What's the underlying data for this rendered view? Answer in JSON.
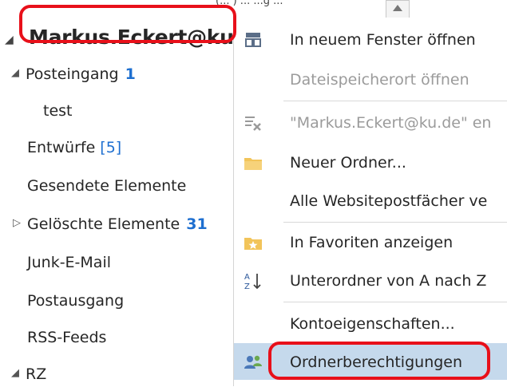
{
  "top_strip": {
    "partial_text": "(...                ) ...                    ...g ..."
  },
  "account": {
    "name": "Markus.Eckert@ku"
  },
  "folders": [
    {
      "label": "Posteingang",
      "count": "1",
      "expand": "open"
    },
    {
      "label": "test"
    },
    {
      "label": "Entwürfe",
      "bracket_count": "[5]"
    },
    {
      "label": "Gesendete Elemente"
    },
    {
      "label": "Gelöschte Elemente",
      "count": "31",
      "expand": "closed"
    },
    {
      "label": "Junk-E-Mail"
    },
    {
      "label": "Postausgang"
    },
    {
      "label": "RSS-Feeds"
    },
    {
      "label": "RZ",
      "expand": "open"
    }
  ],
  "menu": {
    "items": [
      {
        "label": "In neuem Fenster öffnen",
        "icon": "new-window-icon",
        "enabled": true
      },
      {
        "label": "Dateispeicherort öffnen",
        "icon": "",
        "enabled": false
      },
      {
        "label": "\"Markus.Eckert@ku.de\" en",
        "icon": "remove-account-icon",
        "enabled": false
      },
      {
        "label": "Neuer Ordner...",
        "icon": "folder-icon",
        "enabled": true
      },
      {
        "label": "Alle Websitepostfächer ve",
        "icon": "",
        "enabled": true
      },
      {
        "label": "In Favoriten anzeigen",
        "icon": "favorite-star-icon",
        "enabled": true
      },
      {
        "label": "Unterordner von A nach Z",
        "icon": "sort-az-icon",
        "enabled": true
      },
      {
        "label": "Kontoeigenschaften...",
        "icon": "",
        "enabled": true
      },
      {
        "label": "Ordnerberechtigungen",
        "icon": "permissions-icon",
        "enabled": true,
        "highlighted": true
      }
    ]
  },
  "colors": {
    "highlight": "#c5d9ec",
    "annotation": "#e8101a",
    "count_blue": "#1e6fd0"
  }
}
